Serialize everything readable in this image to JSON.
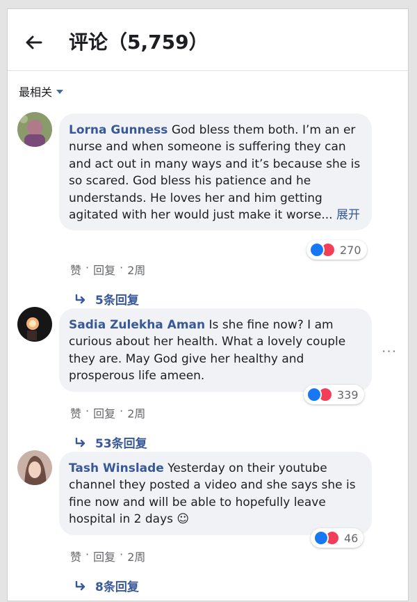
{
  "header": {
    "title": "评论（5,759）",
    "back_icon": "arrow-left-icon"
  },
  "sort": {
    "label": "最相关",
    "icon": "caret-down-icon"
  },
  "actions": {
    "like": "赞",
    "reply": "回复",
    "separator": "·"
  },
  "colors": {
    "link": "#385898",
    "like_blue": "#1877f2",
    "love_red": "#f33e58",
    "bubble": "#f0f2f5"
  },
  "comments": [
    {
      "author": "Lorna Gunness",
      "text": "God bless them both. I’m an er nurse and when someone is suffering they can and act out in many ways and it’s because she is so scared. God bless his patience and he understands. He loves her and him getting agitated with her would just make it worse...",
      "more": "展开",
      "reactions": "270",
      "time": "2周",
      "replies": "5条回复"
    },
    {
      "author": "Sadia Zulekha Aman",
      "text": "Is she fine now? I am curious about her health. What a lovely couple they are. May God give her healthy and prosperous life ameen.",
      "reactions": "339",
      "time": "2周",
      "replies": "53条回复"
    },
    {
      "author": "Tash Winslade",
      "text": "Yesterday on their youtube channel they posted a video and she says she is fine now and will be able to hopefully leave hospital in 2 days ☺",
      "reactions": "46",
      "time": "2周",
      "replies": "8条回复"
    }
  ]
}
